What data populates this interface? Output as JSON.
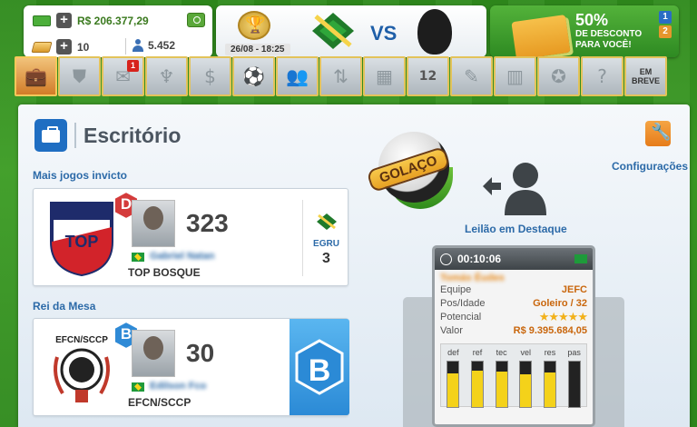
{
  "topbar": {
    "money": "R$ 206.377,29",
    "gold": "10",
    "online_users": "5.452"
  },
  "match": {
    "date": "26/08 - 18:25",
    "vs_label": "VS"
  },
  "promo": {
    "percent": "50%",
    "text": "DE DESCONTO PARA VOCÊ!",
    "badge1": "1",
    "badge2": "2"
  },
  "nav": {
    "mail_badge": "1",
    "soon_label": "EM BREVE",
    "calendar_day": "12"
  },
  "panel": {
    "title": "Escritório",
    "config_label": "Configurações"
  },
  "invicto": {
    "section_label": "Mais jogos invicto",
    "rank": "D",
    "value": "323",
    "manager": "Gabriel Natan",
    "club": "TOP BOSQUE",
    "rival_name": "EGRU",
    "rival_value": "3"
  },
  "rei_da_mesa": {
    "section_label": "Rei da Mesa",
    "rank": "B",
    "value": "30",
    "manager": "Edilson Fco",
    "club": "EFCN/SCCP",
    "big_rank": "B"
  },
  "golaco": {
    "label": "GOLAÇO"
  },
  "auction": {
    "label": "Leilão em Destaque",
    "timer": "00:10:06",
    "player_name": "Tomás Éudes",
    "team_label": "Equipe",
    "team_value": "JEFC",
    "pos_label": "Pos/Idade",
    "pos_value": "Goleiro / 32",
    "potential_label": "Potencial",
    "potential_stars": "★★★★★",
    "value_label": "Valor",
    "value_value": "R$ 9.395.684,05",
    "stats": [
      {
        "label": "def",
        "level": 0.75
      },
      {
        "label": "ref",
        "level": 0.8
      },
      {
        "label": "tec",
        "level": 0.78
      },
      {
        "label": "vel",
        "level": 0.72
      },
      {
        "label": "res",
        "level": 0.76
      },
      {
        "label": "pas",
        "level": 0.0
      }
    ]
  }
}
